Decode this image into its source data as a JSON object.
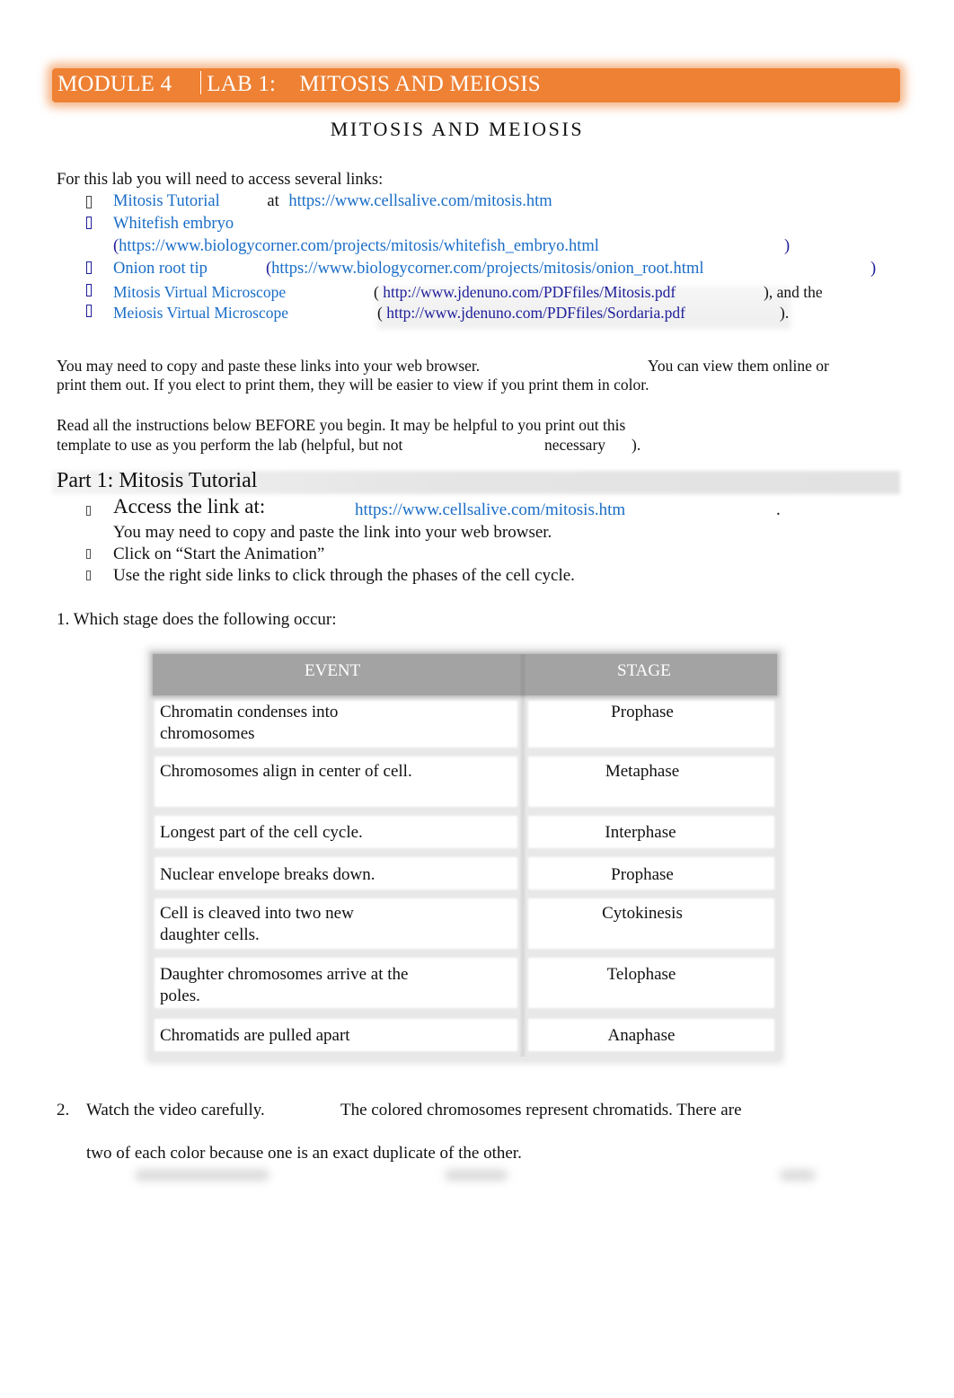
{
  "header": {
    "module": "MODULE 4",
    "lab": "LAB 1:",
    "title": "MITOSIS AND MEIOSIS",
    "accent_color": "#ee8134"
  },
  "doc_title": "MITOSIS AND MEIOSIS",
  "intro": {
    "lead": "For this lab you will need to access several links:",
    "links": [
      {
        "label": "Mitosis Tutorial",
        "connector": "at",
        "url": "https://www.cellsalive.com/mitosis.htm",
        "bullet_icon": "missing-glyph-bullet"
      },
      {
        "label": "Whitefish embryo",
        "open": "(",
        "url": "https://www.biologycorner.com/projects/mitosis/whitefish_embryo.html",
        "close": ")",
        "bullet_icon": "missing-glyph-bullet"
      },
      {
        "label": "Onion root tip",
        "open": "(",
        "url": "https://www.biologycorner.com/projects/mitosis/onion_root.html",
        "close": ")",
        "bullet_icon": "missing-glyph-bullet"
      },
      {
        "label": "Mitosis Virtual Microscope",
        "open": "(",
        "url": "http://www.jdenuno.com/PDFfiles/Mitosis.pdf",
        "close": "), and the",
        "bullet_icon": "missing-glyph-bullet"
      },
      {
        "label": "Meiosis Virtual Microscope",
        "open": "(",
        "url": "http://www.jdenuno.com/PDFfiles/Sordaria.pdf",
        "close": ").",
        "bullet_icon": "missing-glyph-bullet"
      }
    ],
    "link_color": "#1a6dc7"
  },
  "paragraphs": {
    "copy_a": "You may need to copy and paste these links into your web browser.",
    "copy_b": "You can view them online or",
    "copy_c": "print them out. If you elect to print them, they will be easier to view if you print them in color.",
    "read_a": "Read all the instructions below BEFORE you begin. It may be helpful to you print out this",
    "read_b": "template to use as you perform the lab (helpful, but not",
    "read_c": "necessary",
    "read_d": ")."
  },
  "part1": {
    "title": "Part 1: Mitosis Tutorial",
    "steps": [
      {
        "text": "Access the link at:",
        "url": "https://www.cellsalive.com/mitosis.htm",
        "trail": ".",
        "sub": "You may need to copy and paste the link into your web browser."
      },
      {
        "text": "Click on “Start the Animation”"
      },
      {
        "text": "Use the right side links to click through the phases of the cell cycle."
      }
    ]
  },
  "question1": {
    "prompt": "1. Which stage does the following occur:",
    "table": {
      "headers": [
        "EVENT",
        "STAGE"
      ],
      "rows": [
        {
          "event": "Chromatin condenses into chromosomes",
          "stage": "Prophase"
        },
        {
          "event": "Chromosomes align in center of cell.",
          "stage": "Metaphase"
        },
        {
          "event": "Longest part of the cell cycle.",
          "stage": "Interphase"
        },
        {
          "event": "Nuclear envelope breaks down.",
          "stage": "Prophase"
        },
        {
          "event": "Cell is cleaved into two new daughter cells.",
          "stage": "Cytokinesis"
        },
        {
          "event": "Daughter chromosomes arrive at the poles.",
          "stage": "Telophase"
        },
        {
          "event": "Chromatids are pulled apart",
          "stage": "Anaphase"
        }
      ]
    }
  },
  "question2": {
    "number": "2.",
    "a": "Watch the video carefully.",
    "b": "The colored chromosomes represent chromatids. There are",
    "c": "two of each color because one is an exact duplicate of the other."
  }
}
